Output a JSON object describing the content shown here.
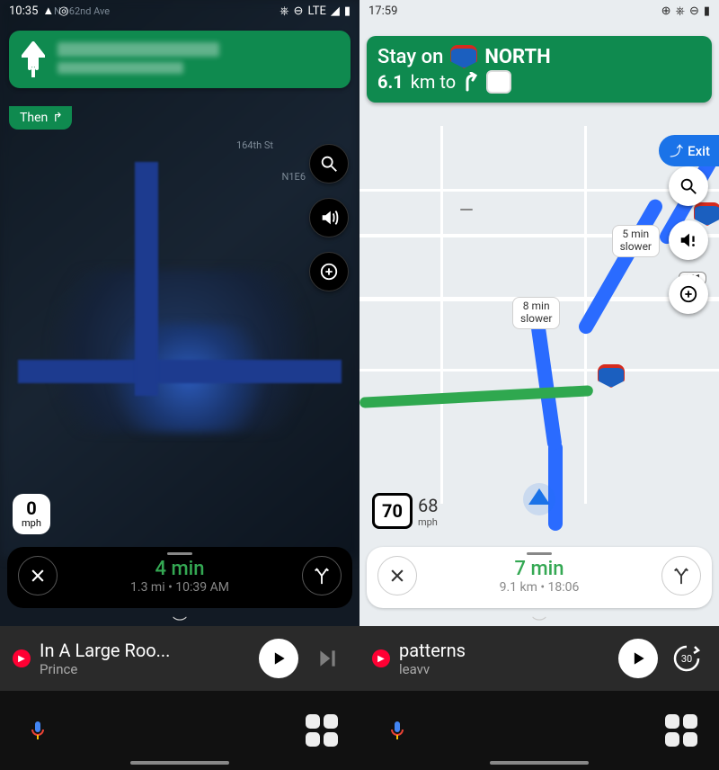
{
  "left": {
    "status": {
      "time": "10:35",
      "net": "LTE"
    },
    "direction": {
      "then_label": "Then"
    },
    "map_labels": {
      "l1": "N 162nd Ave",
      "l2": "164th St",
      "l3": "N1E6"
    },
    "speed": {
      "value": "0",
      "unit": "mph"
    },
    "trip": {
      "eta": "4 min",
      "sub": "1.3 mi  •  10:39 AM"
    },
    "media": {
      "title": "In A Large Roo...",
      "artist": "Prince"
    }
  },
  "right": {
    "status": {
      "time": "17:59"
    },
    "direction": {
      "line1_prefix": "Stay on",
      "line1_suffix": "NORTH",
      "line2_prefix": "6.1",
      "line2_mid": "km to"
    },
    "exit_label": "Exit",
    "alt_routes": {
      "a": "5 min\nslower",
      "b": "8 min\nslower"
    },
    "map_labels": {
      "r1": "411"
    },
    "speed": {
      "limit": "70",
      "current": "68",
      "unit": "mph"
    },
    "trip": {
      "eta": "7 min",
      "sub": "9.1 km  •  18:06"
    },
    "media": {
      "title": "patterns",
      "artist": "leavv",
      "skip_seconds": "30"
    }
  }
}
